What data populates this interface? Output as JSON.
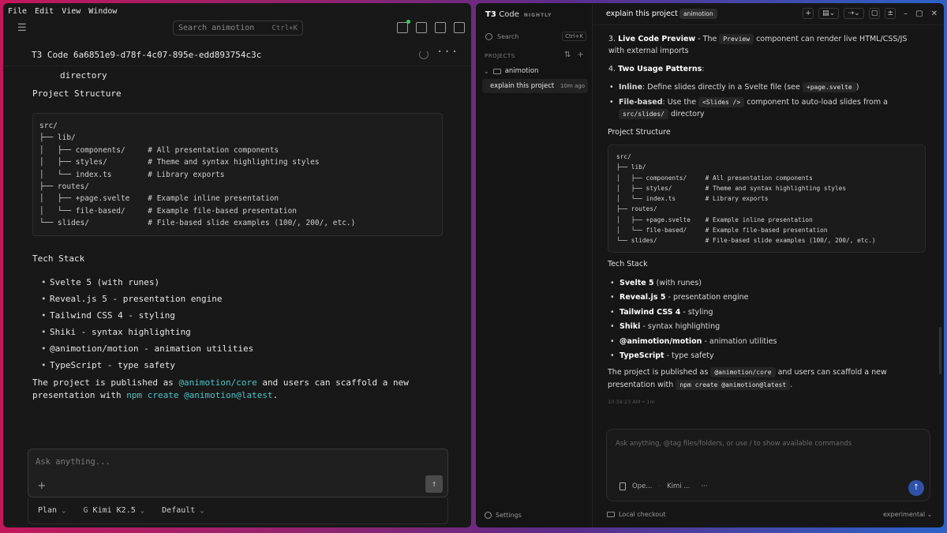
{
  "left": {
    "menu": [
      "File",
      "Edit",
      "View",
      "Window"
    ],
    "search": {
      "placeholder": "Search animotion",
      "shortcut": "Ctrl+K"
    },
    "thread_title": "T3 Code 6a6851e9-d78f-4c07-895e-edd893754c3c",
    "directory_text": "directory",
    "project_structure_heading": "Project Structure",
    "code_lines": [
      "src/",
      "├── lib/",
      "│   ├── components/     # All presentation components",
      "│   ├── styles/         # Theme and syntax highlighting styles",
      "│   └── index.ts        # Library exports",
      "├── routes/",
      "│   ├── +page.svelte    # Example inline presentation",
      "│   └── file-based/     # Example file-based presentation",
      "└── slides/             # File-based slide examples (100/, 200/, etc.)"
    ],
    "tech_heading": "Tech Stack",
    "tech_items": [
      "Svelte 5 (with runes)",
      "Reveal.js 5 - presentation engine",
      "Tailwind CSS 4 - styling",
      "Shiki - syntax highlighting",
      "@animotion/motion - animation utilities",
      "TypeScript - type safety"
    ],
    "para_prefix": "The project is published as ",
    "para_link1": "@animotion/core",
    "para_mid": " and users can scaffold a new presentation with ",
    "para_link2": "npm create @animotion@latest",
    "para_end": ".",
    "composer_placeholder": "Ask anything...",
    "footer": {
      "mode": "Plan",
      "model": "Kimi K2.5",
      "access": "Default"
    }
  },
  "right": {
    "brand": "T3",
    "brand_code": "Code",
    "brand_tag": "NIGHTLY",
    "search_label": "Search",
    "search_shortcut": "Ctrl+K",
    "projects_label": "PROJECTS",
    "project_name": "animotion",
    "thread_name": "explain this project",
    "thread_age": "10m ago",
    "settings_label": "Settings",
    "header_title": "explain this project",
    "header_badge": "animotion",
    "item3_num": "3.",
    "item3_title": "Live Code Preview",
    "item3_a": " - The ",
    "item3_chip": "Preview",
    "item3_b": " component can render live HTML/CSS/JS with external imports",
    "item4_num": "4.",
    "item4_title": "Two Usage Patterns",
    "item4_colon": ":",
    "inline_title": "Inline",
    "inline_text": ": Define slides directly in a Svelte file (see ",
    "inline_chip": "+page.svelte",
    "inline_end": ")",
    "file_title": "File-based",
    "file_text": ": Use the ",
    "file_chip": "<Slides />",
    "file_text2": " component to auto-load slides from a ",
    "file_chip2": "src/slides/",
    "file_end": " directory",
    "structure_heading": "Project Structure",
    "tech_heading": "Tech Stack",
    "tech_items": [
      {
        "name": "Svelte 5",
        "desc": " (with runes)"
      },
      {
        "name": "Reveal.js 5",
        "desc": " - presentation engine"
      },
      {
        "name": "Tailwind CSS 4",
        "desc": " - styling"
      },
      {
        "name": "Shiki",
        "desc": " - syntax highlighting"
      },
      {
        "name": "@animotion/motion",
        "desc": " - animation utilities"
      },
      {
        "name": "TypeScript",
        "desc": " - type safety"
      }
    ],
    "para_a": "The project is published as ",
    "para_chip1": "@animotion/core",
    "para_b": " and users can scaffold a new presentation with ",
    "para_chip2": "npm create @animotion@latest",
    "para_c": ".",
    "timestamp": "10:39:23 AM • 1m",
    "composer_placeholder": "Ask anything, @tag files/folders, or use / to show available commands",
    "composer_agent": "Ope...",
    "composer_model": "Kimi ...",
    "footer_left": "Local checkout",
    "footer_right": "experimental"
  },
  "colors": {
    "link": "#4fc3c8",
    "send": "#2f52a8",
    "badge_green": "#3fcf5e"
  }
}
